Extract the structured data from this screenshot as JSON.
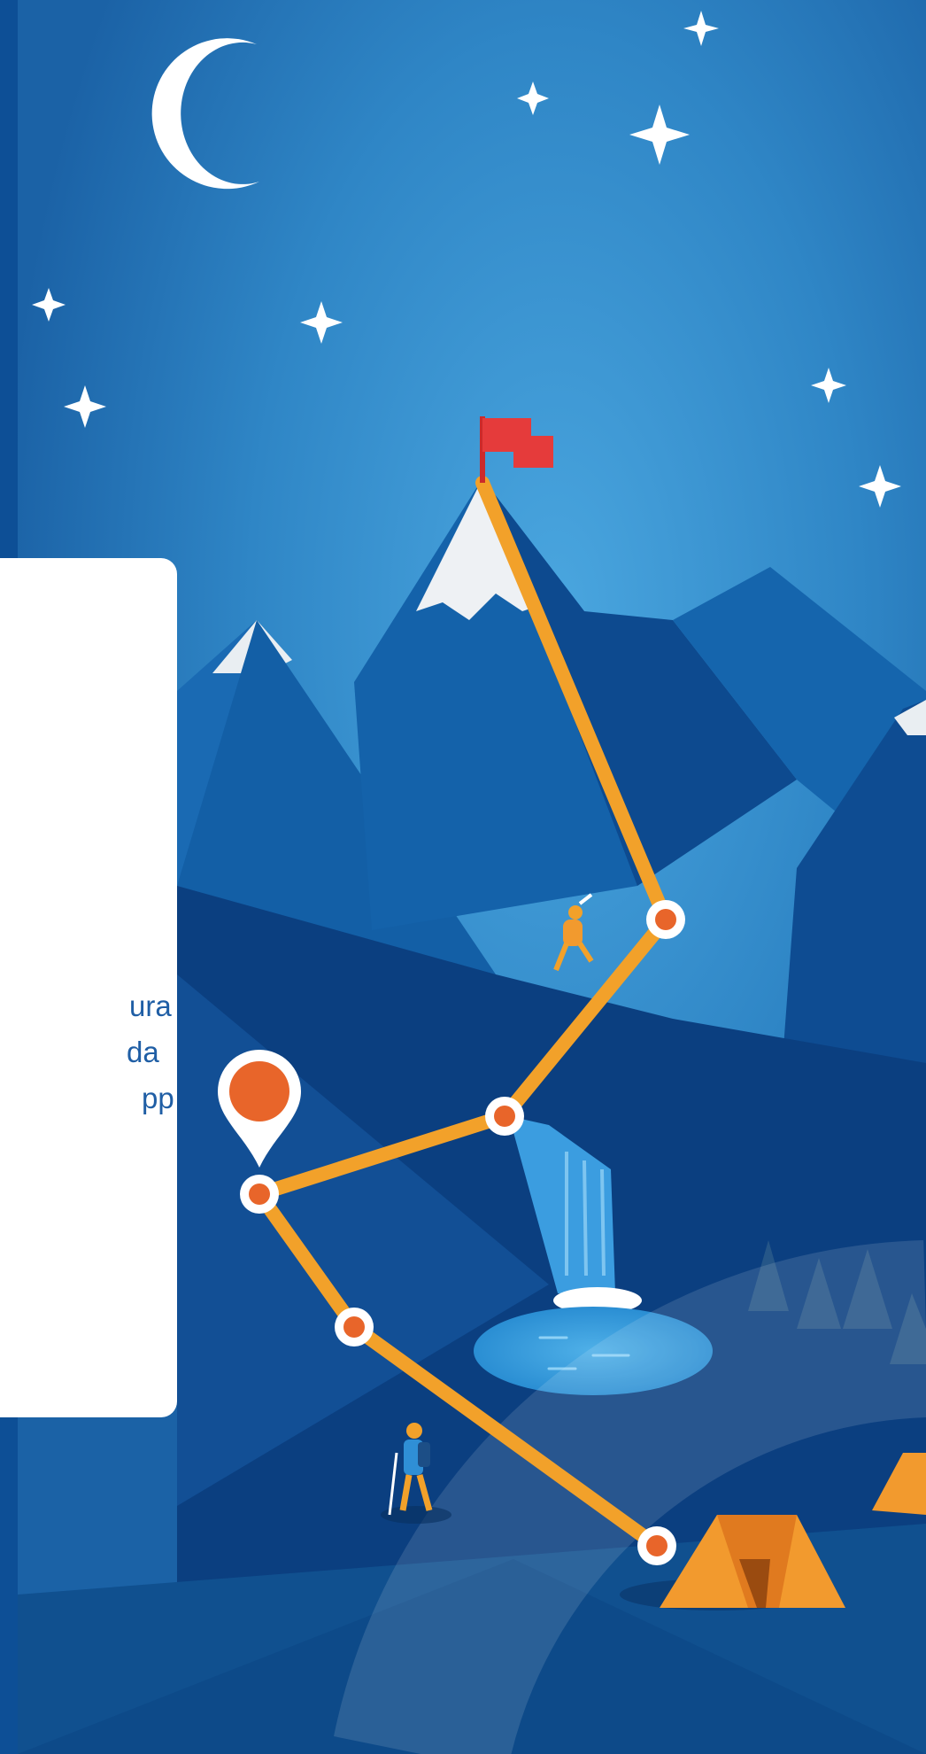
{
  "card": {
    "text_lines": [
      "ura",
      "da",
      "pp e"
    ]
  },
  "colors": {
    "sky_top": "#1b62a6",
    "sky_mid": "#3e9ad6",
    "mountain_dark": "#0b3d7c",
    "mountain_mid": "#135fa6",
    "trail": "#f2a12a",
    "waypoint": "#e8652a",
    "flag": "#e53b3b",
    "tent": "#f29a2e",
    "card_text": "#1f5ea5"
  },
  "icons": [
    "moon-icon",
    "star-icon",
    "flag-icon",
    "location-pin-icon",
    "waypoint-icon",
    "tent-icon",
    "climber-figure",
    "hiker-figure",
    "waterfall",
    "lake",
    "pine-tree-icon"
  ]
}
